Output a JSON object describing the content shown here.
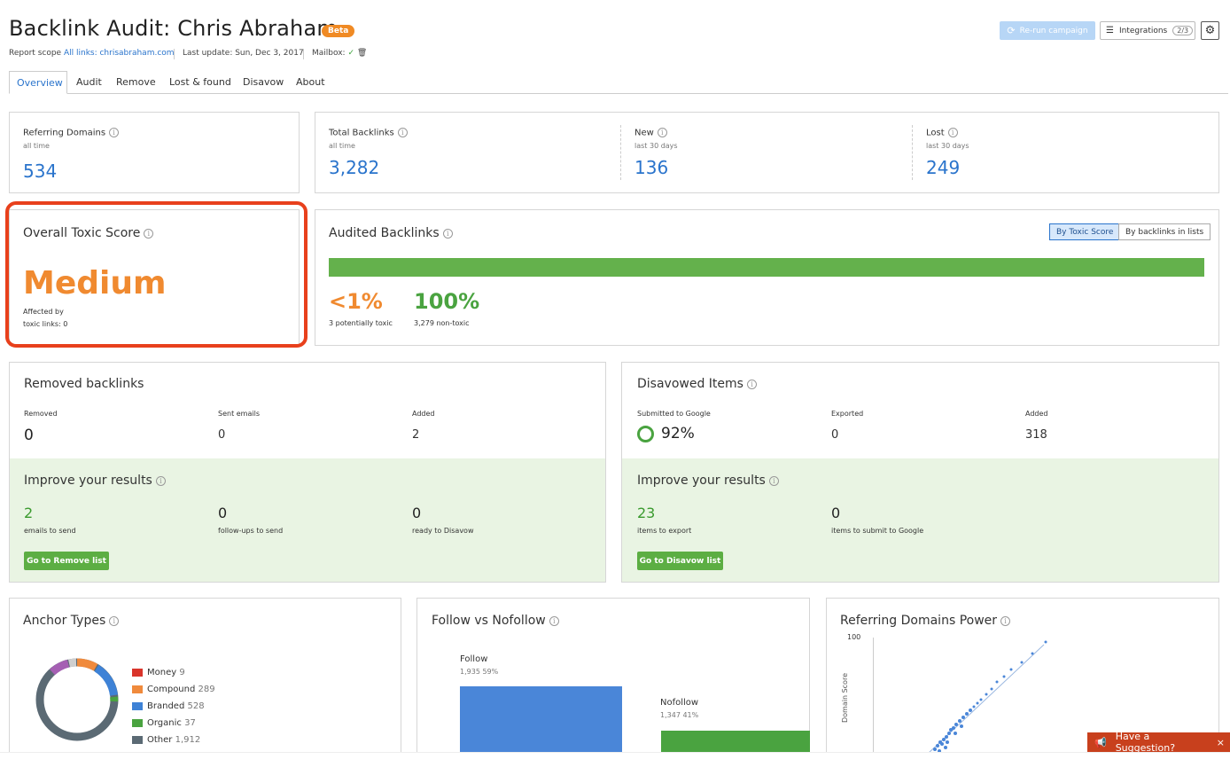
{
  "header": {
    "title": "Backlink Audit: Chris Abraham",
    "beta": "Beta",
    "report_scope_label": "Report scope",
    "report_scope_link": "All links: chrisabraham.com",
    "last_update": "Last update: Sun, Dec 3, 2017",
    "mailbox_label": "Mailbox:",
    "rerun_label": "Re-run campaign",
    "integrations_label": "Integrations",
    "integrations_count": "2/3"
  },
  "tabs": [
    {
      "label": "Overview",
      "active": true
    },
    {
      "label": "Audit"
    },
    {
      "label": "Remove"
    },
    {
      "label": "Lost & found"
    },
    {
      "label": "Disavow"
    },
    {
      "label": "About"
    }
  ],
  "referring_domains": {
    "title": "Referring Domains",
    "sub": "all time",
    "value": "534"
  },
  "backlinks": [
    {
      "title": "Total Backlinks",
      "sub": "all time",
      "value": "3,282"
    },
    {
      "title": "New",
      "sub": "last 30 days",
      "value": "136"
    },
    {
      "title": "Lost",
      "sub": "last 30 days",
      "value": "249"
    }
  ],
  "toxic": {
    "title": "Overall Toxic Score",
    "value": "Medium",
    "affected_1": "Affected by",
    "affected_2": "toxic links: 0"
  },
  "audited": {
    "title": "Audited Backlinks",
    "toggle_1": "By Toxic Score",
    "toggle_2": "By backlinks in lists",
    "toxic_pct": "<1%",
    "toxic_sub": "3 potentially toxic",
    "nontoxic_pct": "100%",
    "nontoxic_sub": "3,279 non-toxic",
    "nontoxic_share": 1.0
  },
  "removed": {
    "title": "Removed backlinks",
    "cols": [
      {
        "label": "Removed",
        "value": "0"
      },
      {
        "label": "Sent emails",
        "value": "0"
      },
      {
        "label": "Added",
        "value": "2"
      }
    ],
    "improve_title": "Improve your results",
    "improve": [
      {
        "value": "2",
        "label": "emails to send"
      },
      {
        "value": "0",
        "label": "follow-ups to send"
      },
      {
        "value": "0",
        "label": "ready to Disavow"
      }
    ],
    "button": "Go to Remove list"
  },
  "disavowed": {
    "title": "Disavowed Items",
    "cols": [
      {
        "label": "Submitted to Google",
        "value": "92%"
      },
      {
        "label": "Exported",
        "value": "0"
      },
      {
        "label": "Added",
        "value": "318"
      }
    ],
    "improve_title": "Improve your results",
    "improve": [
      {
        "value": "23",
        "label": "items to export"
      },
      {
        "value": "0",
        "label": "items to submit to Google"
      }
    ],
    "button": "Go to Disavow list"
  },
  "anchor_types": {
    "title": "Anchor Types",
    "legend": [
      {
        "name": "Money",
        "value": "9",
        "color": "#d9342b"
      },
      {
        "name": "Compound",
        "value": "289",
        "color": "#f08a3c"
      },
      {
        "name": "Branded",
        "value": "528",
        "color": "#3e82d6"
      },
      {
        "name": "Organic",
        "value": "37",
        "color": "#4aa340"
      },
      {
        "name": "Other",
        "value": "1,912",
        "color": "#5b6a74"
      }
    ]
  },
  "follow": {
    "title": "Follow vs Nofollow",
    "follow_label": "Follow",
    "follow_stats": "1,935  59%",
    "nofollow_label": "Nofollow",
    "nofollow_stats": "1,347  41%",
    "colors": {
      "follow": "#4a86d8",
      "nofollow": "#4aa340"
    }
  },
  "rdp": {
    "title": "Referring Domains Power",
    "y_max": "100",
    "y_label": "Domain Score"
  },
  "suggest": "Have a Suggestion?"
}
